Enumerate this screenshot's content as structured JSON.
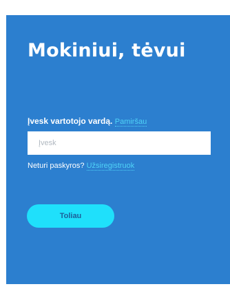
{
  "login": {
    "title": "Mokiniui, tėvui",
    "username_label": "Įvesk vartotojo vardą.",
    "forgot_link": "Pamiršau",
    "username_placeholder": "Įvesk",
    "username_value": "",
    "no_account_text": "Neturi paskyros?",
    "register_link": "Užsiregistruok",
    "submit_label": "Toliau"
  },
  "colors": {
    "panel_background": "#2c7fcf",
    "link": "#4fd3f7",
    "button_background": "#1fe0fb",
    "button_text": "#1d5f99"
  }
}
